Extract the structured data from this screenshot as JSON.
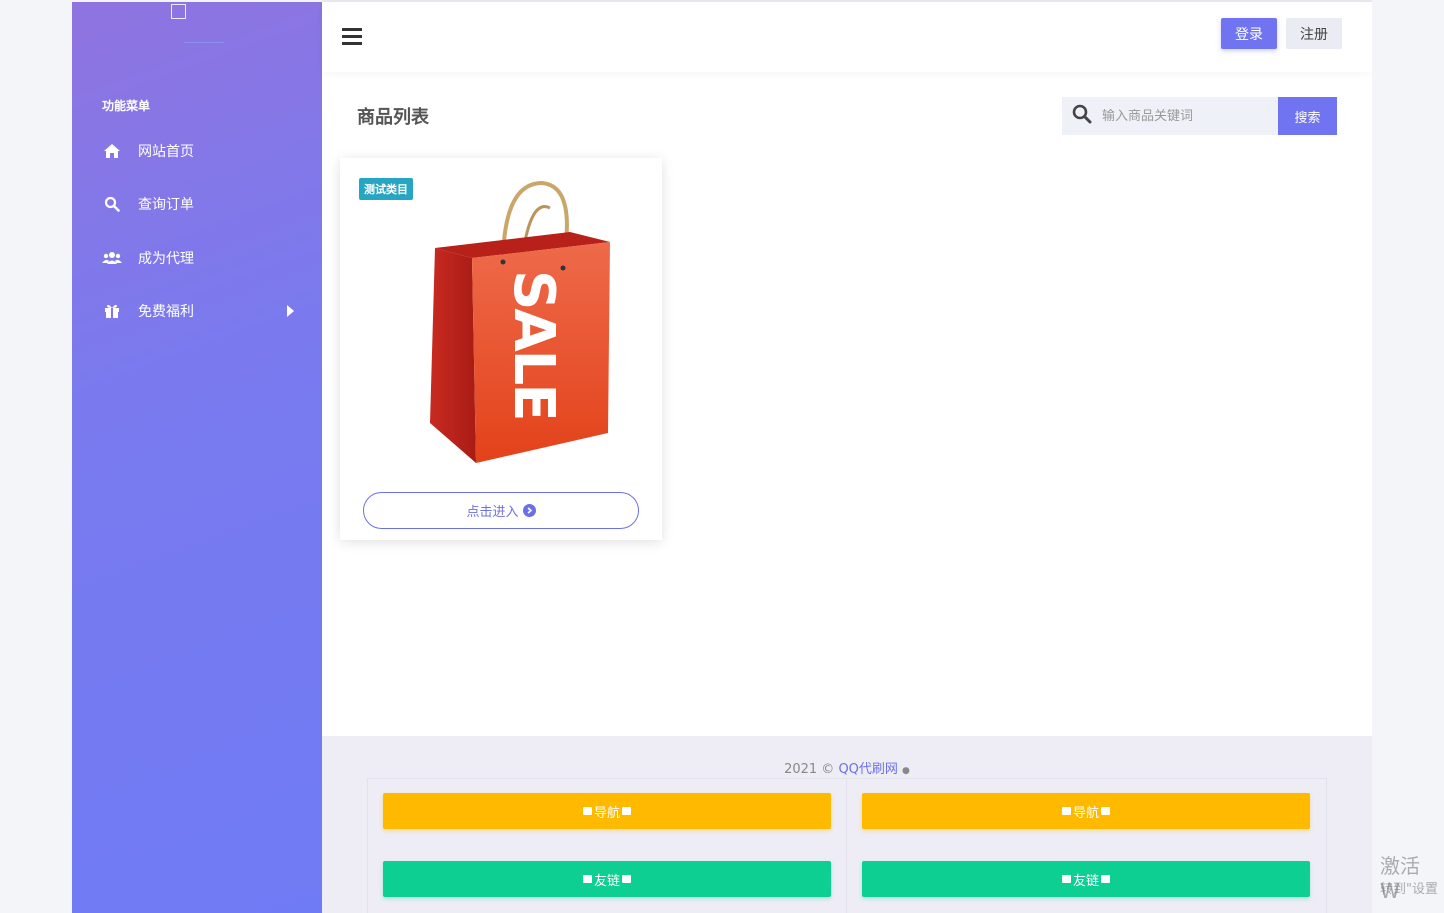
{
  "sidebar": {
    "menu_title": "功能菜单",
    "items": [
      {
        "label": "网站首页",
        "icon": "home-icon"
      },
      {
        "label": "查询订单",
        "icon": "search-icon"
      },
      {
        "label": "成为代理",
        "icon": "users-icon"
      },
      {
        "label": "免费福利",
        "icon": "gift-icon"
      }
    ]
  },
  "header": {
    "login_label": "登录",
    "register_label": "注册"
  },
  "main": {
    "page_title": "商品列表",
    "search": {
      "placeholder": "输入商品关键词",
      "button_label": "搜索"
    },
    "products": [
      {
        "category_badge": "测试类目",
        "image_text": "SALE",
        "enter_label": "点击进入"
      }
    ]
  },
  "footer": {
    "copyright_prefix": "2021 © ",
    "brand": "QQ代刷网",
    "buttons": [
      {
        "label": "导航",
        "color": "#ffba00"
      },
      {
        "label": "导航",
        "color": "#ffba00"
      },
      {
        "label": "友链",
        "color": "#0ecf92"
      },
      {
        "label": "友链",
        "color": "#0ecf92"
      }
    ]
  },
  "watermark": {
    "line1": "激活 W",
    "line2": "转到\"设置"
  },
  "colors": {
    "accent": "#7074f0",
    "nav_yellow": "#ffba00",
    "link_green": "#0ecf92",
    "badge_teal": "#26a6c2"
  }
}
